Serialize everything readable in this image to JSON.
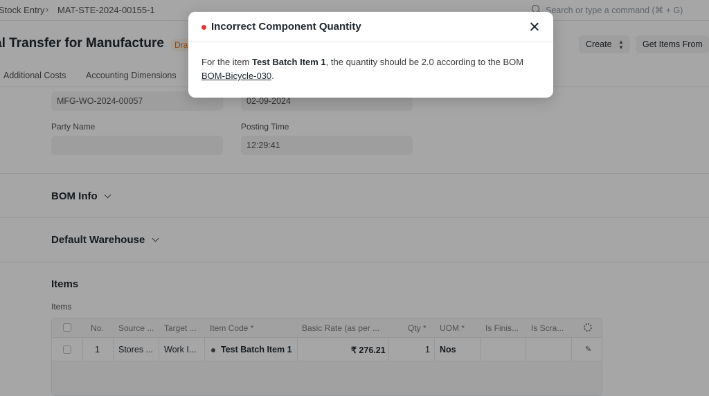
{
  "breadcrumb": {
    "parent": "Stock Entry",
    "current": "MAT-STE-2024-00155-1"
  },
  "search": {
    "placeholder": "Search or type a command (⌘ + G)"
  },
  "page_head": {
    "title": "al Transfer for Manufacture",
    "status": "Draft",
    "create_label": "Create",
    "get_items_label": "Get Items From"
  },
  "tabs": [
    "Additional Costs",
    "Accounting Dimensions"
  ],
  "form": {
    "work_order": "MFG-WO-2024-00057",
    "posting_date": "02-09-2024",
    "party_name_label": "Party Name",
    "party_name_value": "",
    "posting_time_label": "Posting Time",
    "posting_time_value": "12:29:41",
    "sections": {
      "bom_info": "BOM Info",
      "default_warehouse": "Default Warehouse",
      "items": "Items"
    },
    "items_field_label": "Items"
  },
  "items_table": {
    "columns": [
      "No.",
      "Source ...",
      "Target ...",
      "Item Code *",
      "Basic Rate (as per ...",
      "Qty *",
      "UOM *",
      "Is Finis...",
      "Is Scra..."
    ],
    "rows": [
      {
        "no": "1",
        "source": "Stores ...",
        "target": "Work I...",
        "item_code": "Test Batch Item 1",
        "basic_rate": "₹ 276.21",
        "qty": "1",
        "uom": "Nos"
      }
    ]
  },
  "dialog": {
    "title": "Incorrect Component Quantity",
    "indicator_color": "#e03636",
    "message_prefix": "For the item ",
    "item_name": "Test Batch Item 1",
    "message_middle": ", the quantity should be 2.0 according to the BOM ",
    "bom_link": "BOM-Bicycle-030",
    "message_suffix": "."
  }
}
